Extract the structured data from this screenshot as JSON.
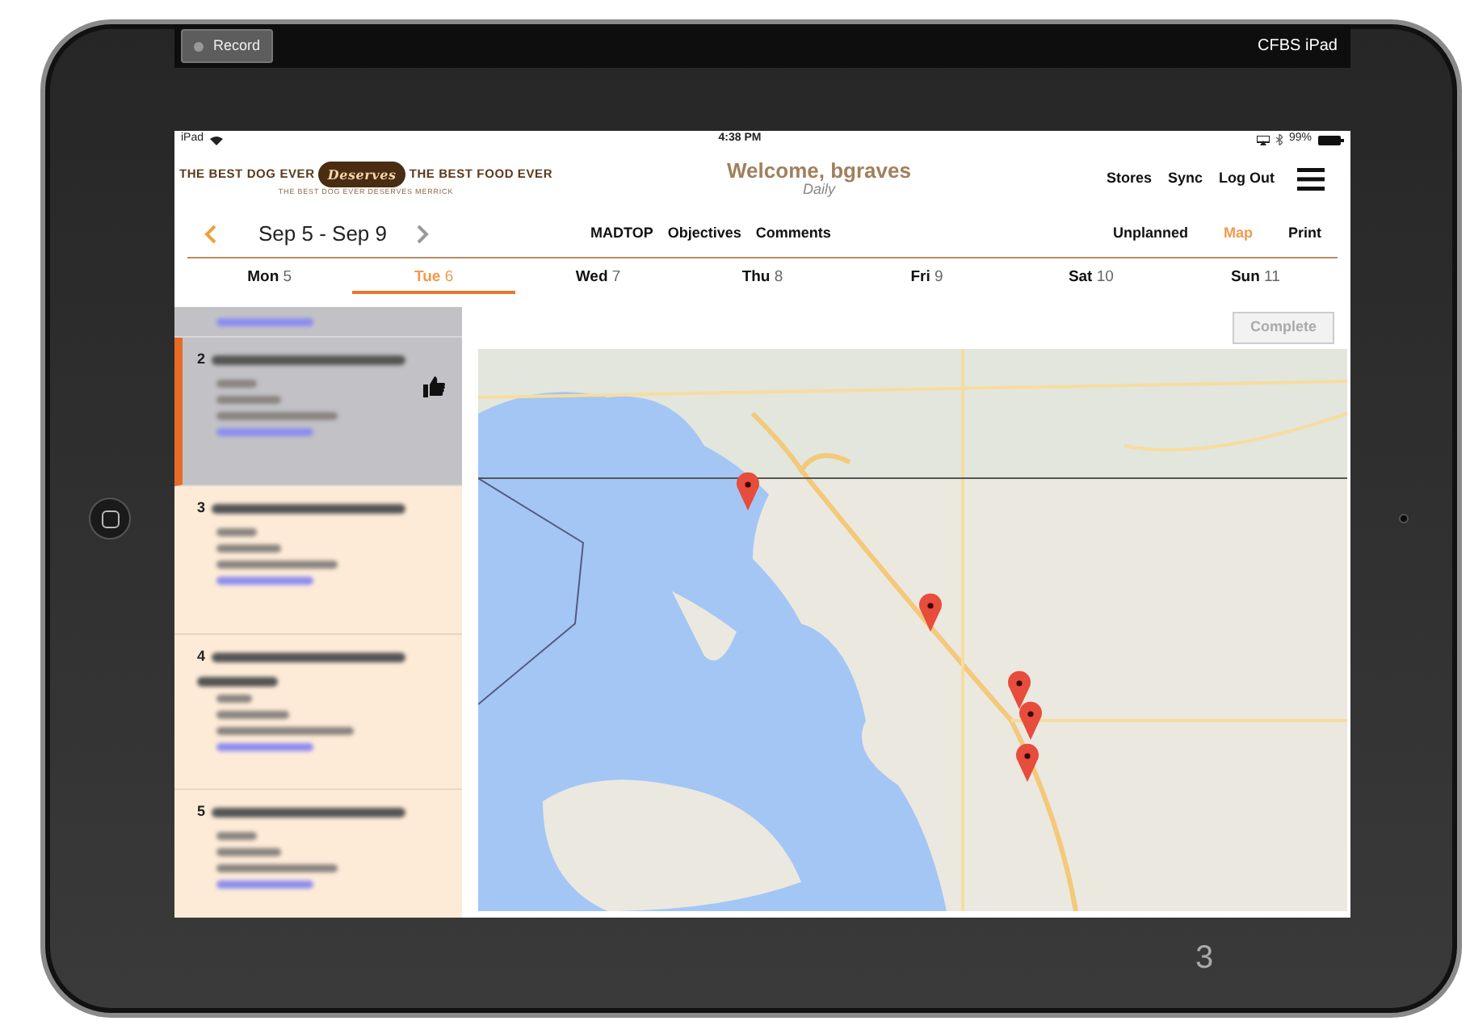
{
  "recorder": {
    "button": "Record",
    "device": "CFBS iPad"
  },
  "status_bar": {
    "carrier": "iPad",
    "time": "4:38 PM",
    "battery": "99%"
  },
  "header": {
    "logo": {
      "left": "THE BEST DOG EVER",
      "badge": "Deserves",
      "right": "THE BEST FOOD EVER",
      "tagline": "THE BEST DOG EVER DESERVES MERRICK"
    },
    "welcome": "Welcome, bgraves",
    "mode": "Daily",
    "links": [
      "Stores",
      "Sync",
      "Log Out"
    ]
  },
  "week": {
    "range": "Sep 5 - Sep 9"
  },
  "center_links": [
    "MADTOP",
    "Objectives",
    "Comments"
  ],
  "view_tabs": [
    {
      "label": "Unplanned",
      "selected": false
    },
    {
      "label": "Map",
      "selected": true
    },
    {
      "label": "Print",
      "selected": false
    }
  ],
  "days": [
    {
      "name": "Mon",
      "date": "5",
      "selected": false
    },
    {
      "name": "Tue",
      "date": "6",
      "selected": true
    },
    {
      "name": "Wed",
      "date": "7",
      "selected": false
    },
    {
      "name": "Thu",
      "date": "8",
      "selected": false
    },
    {
      "name": "Fri",
      "date": "9",
      "selected": false
    },
    {
      "name": "Sat",
      "date": "10",
      "selected": false
    },
    {
      "name": "Sun",
      "date": "11",
      "selected": false
    }
  ],
  "complete_button": {
    "label": "Complete",
    "disabled": true
  },
  "stops": [
    {
      "kind": "partial",
      "visited": true,
      "selected": false,
      "approved": false
    },
    {
      "kind": "full",
      "number": "2",
      "visited": true,
      "selected": true,
      "approved": true
    },
    {
      "kind": "full",
      "number": "3",
      "visited": false,
      "selected": false,
      "approved": false
    },
    {
      "kind": "tall",
      "number": "4",
      "visited": false,
      "selected": false,
      "approved": false
    },
    {
      "kind": "full",
      "number": "5",
      "visited": false,
      "selected": false,
      "approved": false
    }
  ],
  "slide_number": "3"
}
